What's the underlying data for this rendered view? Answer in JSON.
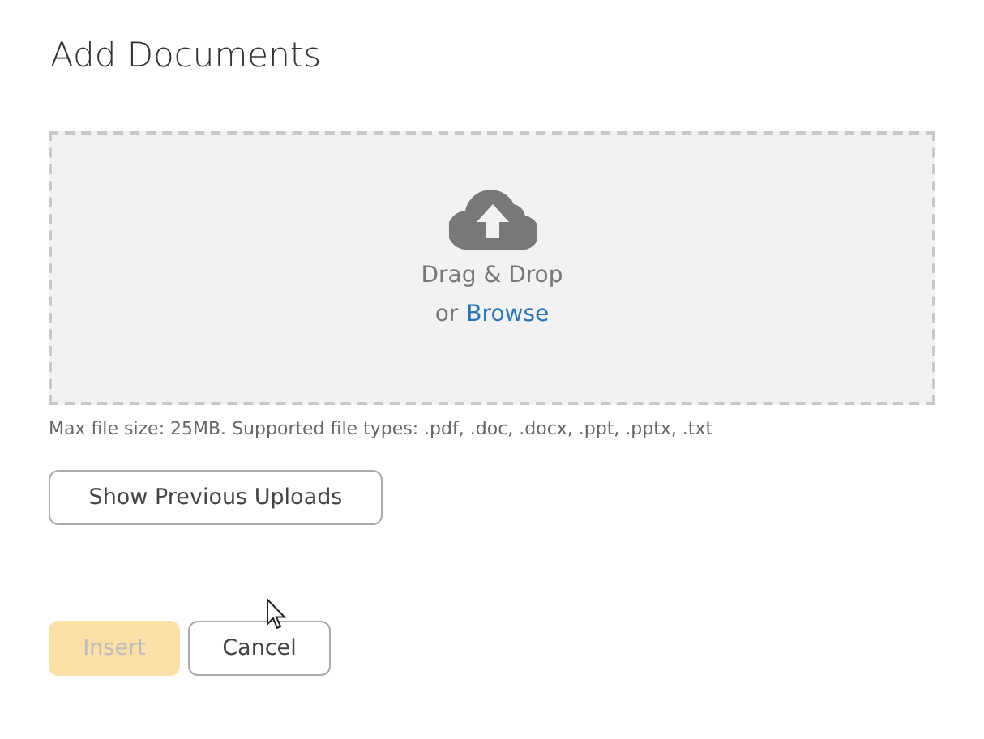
{
  "dialog": {
    "title": "Add Documents"
  },
  "dropzone": {
    "instruction": "Drag & Drop",
    "prefix": "or",
    "link": "Browse"
  },
  "hint": "Max file size: 25MB. Supported file types: .pdf, .doc, .docx, .ppt, .pptx, .txt",
  "history_button": "Show Previous Uploads",
  "actions": [
    {
      "label": "Insert",
      "kind": "primary",
      "disabled": true
    },
    {
      "label": "Cancel",
      "kind": "secondary",
      "disabled": false
    }
  ]
}
